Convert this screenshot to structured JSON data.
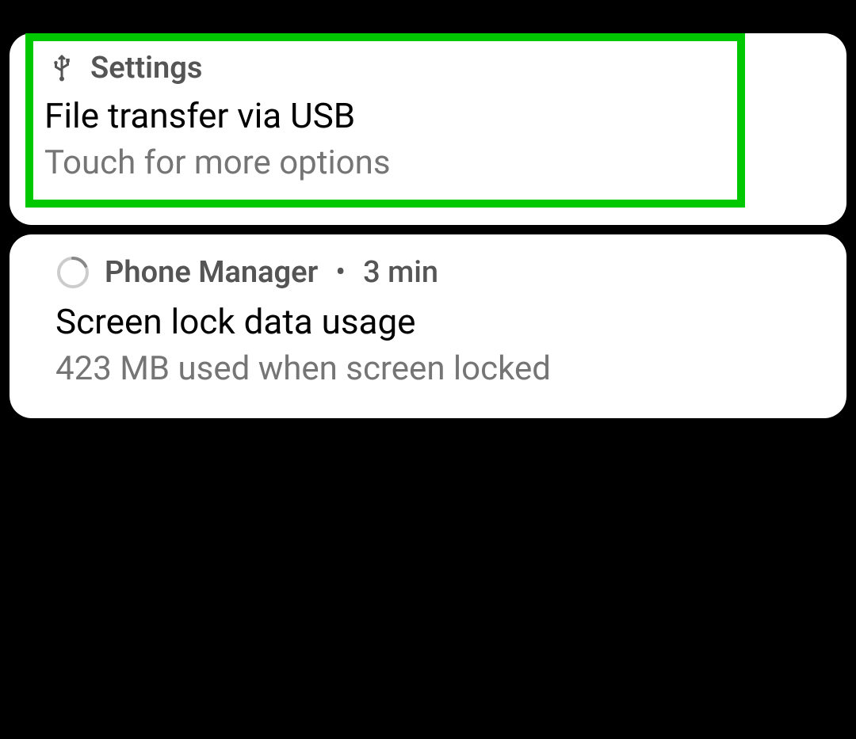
{
  "notifications": [
    {
      "app": "Settings",
      "title": "File transfer via USB",
      "subtitle": "Touch for more options",
      "highlighted": true,
      "highlight_color": "#00c800"
    },
    {
      "app": "Phone Manager",
      "time": "3 min",
      "title": "Screen lock data usage",
      "subtitle": "423 MB used when screen locked",
      "highlighted": false
    }
  ]
}
